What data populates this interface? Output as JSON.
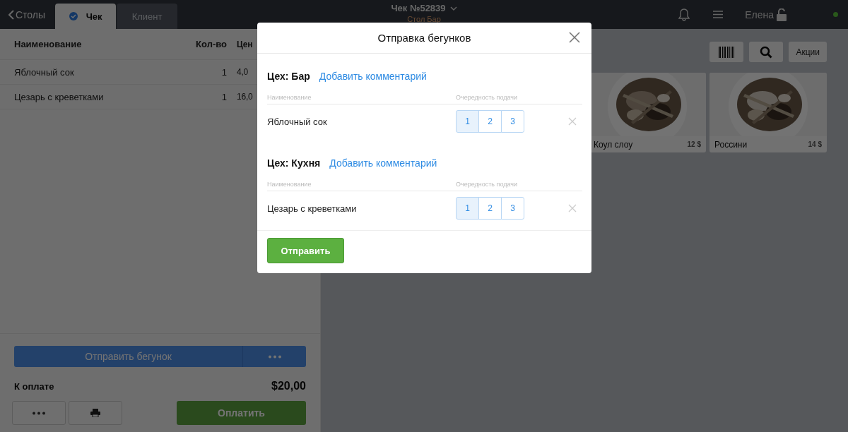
{
  "topbar": {
    "back": "Столы",
    "tabs": [
      {
        "label": "Чек",
        "selected": true
      },
      {
        "label": "Клиент",
        "selected": false
      }
    ],
    "title": "Чек №52839",
    "subtitle": "Стол Бар",
    "user": "Елена",
    "online": true
  },
  "order": {
    "columns": [
      "Наименование",
      "Кол-во",
      "Цен"
    ],
    "rows": [
      {
        "name": "Яблочный сок",
        "qty": "1",
        "price": "4,0"
      },
      {
        "name": "Цезарь с креветками",
        "qty": "1",
        "price": "16,0"
      }
    ],
    "send_button": "Отправить бегунок",
    "total_label": "К оплате",
    "total": "$20,00",
    "pay_button": "Оплатить"
  },
  "catalog": {
    "promo_button": "Акции",
    "products": [
      {
        "name": "Коул слоу",
        "price": "12 $",
        "kind": "picture"
      },
      {
        "name": "Россини",
        "price": "14 $",
        "kind": "picture"
      }
    ]
  },
  "dialog": {
    "title": "Отправка бегунков",
    "sections": [
      {
        "workshop": "Цех: Бар",
        "comment_link": "Добавить комментарий",
        "columns": [
          "Наименование",
          "Очередность подачи"
        ],
        "items": [
          {
            "name": "Яблочный сок",
            "order": [
              {
                "label": "1",
                "selected": true
              },
              {
                "label": "2",
                "selected": false
              },
              {
                "label": "3",
                "selected": false
              }
            ]
          }
        ]
      },
      {
        "workshop": "Цех: Кухня",
        "comment_link": "Добавить комментарий",
        "columns": [
          "Наименование",
          "Очередность подачи"
        ],
        "items": [
          {
            "name": "Цезарь с креветками",
            "order": [
              {
                "label": "1",
                "selected": true
              },
              {
                "label": "2",
                "selected": false
              },
              {
                "label": "3",
                "selected": false
              }
            ]
          }
        ]
      }
    ],
    "submit": "Отправить"
  }
}
